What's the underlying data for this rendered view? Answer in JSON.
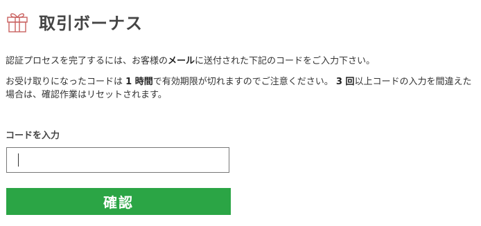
{
  "header": {
    "icon": "gift-icon",
    "title": "取引ボーナス"
  },
  "instructions": {
    "line1_part1": "認証プロセスを完了するには、お客様の",
    "line1_bold": "メール",
    "line1_part2": "に送付された下記のコードをご入力下さい。",
    "line2_part1": "お受け取りになったコードは ",
    "line2_bold1": "1 時間",
    "line2_part2": "で有効期限が切れますのでご注意ください。 ",
    "line2_bold2": "3 回",
    "line2_part3": "以上コードの入力を間違えた場合は、確認作業はリセットされます。"
  },
  "form": {
    "code_label": "コードを入力",
    "code_value": "",
    "confirm_label": "確認"
  },
  "colors": {
    "accent_green": "#2ba545",
    "gift_icon_red": "#c9605f"
  }
}
